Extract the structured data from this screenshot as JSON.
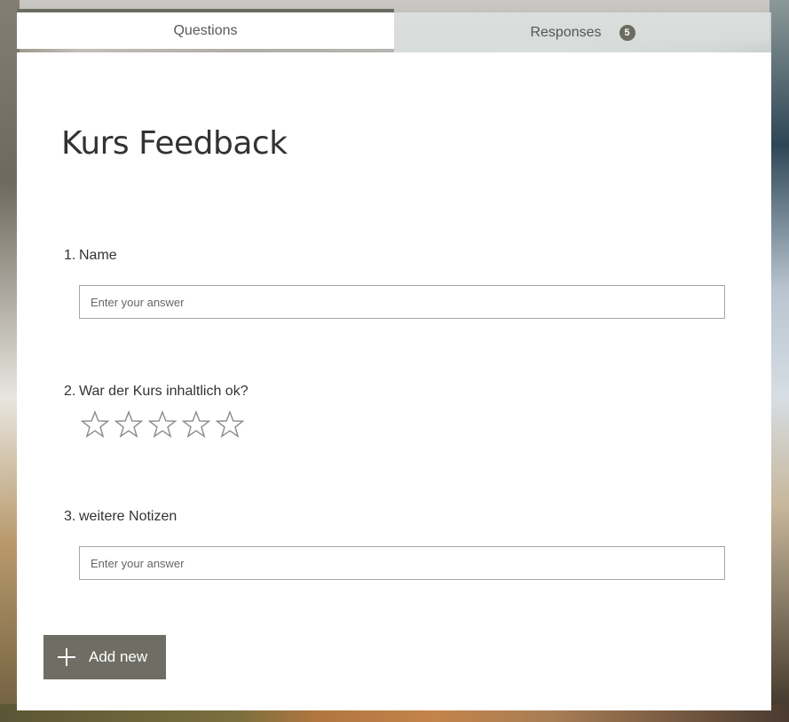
{
  "tabs": [
    {
      "label": "Questions",
      "active": true
    },
    {
      "label": "Responses",
      "active": false,
      "badge": "5"
    }
  ],
  "form": {
    "title": "Kurs Feedback",
    "questions": [
      {
        "number": "1.",
        "text": "Name",
        "type": "text",
        "placeholder": "Enter your answer"
      },
      {
        "number": "2.",
        "text": "War der Kurs inhaltlich ok?",
        "type": "rating",
        "stars": 5,
        "rating": 0
      },
      {
        "number": "3.",
        "text": "weitere Notizen",
        "type": "text",
        "placeholder": "Enter your answer"
      }
    ]
  },
  "add_button": {
    "label": "Add new",
    "icon": "plus-icon"
  },
  "colors": {
    "accent": "#6f6e64",
    "star_outline": "#8a8a8a"
  }
}
